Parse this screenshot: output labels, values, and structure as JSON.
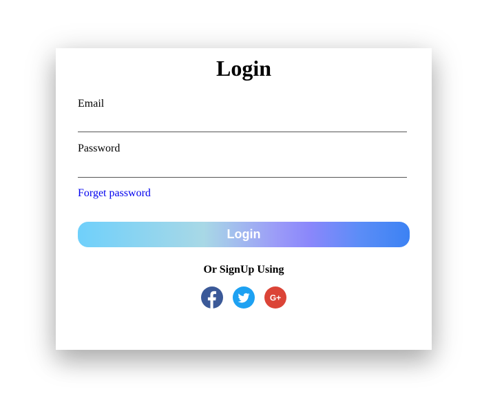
{
  "login_form": {
    "title": "Login",
    "email": {
      "label": "Email",
      "value": "",
      "placeholder": ""
    },
    "password": {
      "label": "Password",
      "value": "",
      "placeholder": ""
    },
    "forget_password_link": "Forget password",
    "submit_label": "Login",
    "alt_signup_text": "Or SignUp Using",
    "social_buttons": [
      {
        "icon": "facebook-icon",
        "color": "#3b5998"
      },
      {
        "icon": "twitter-icon",
        "color": "#1da1f2"
      },
      {
        "icon": "google-plus-icon",
        "color": "#db4437"
      }
    ]
  },
  "colors": {
    "button_gradient_start": "#6fd0fb",
    "button_gradient_mid": "#8a87fb",
    "button_gradient_end": "#3c82f3",
    "link": "#0000ee"
  }
}
